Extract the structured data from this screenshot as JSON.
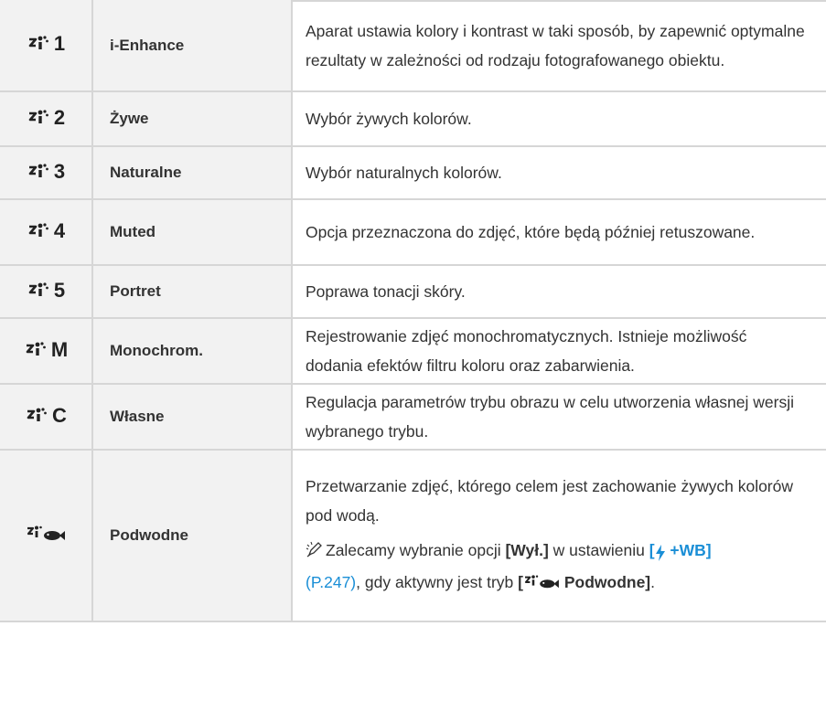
{
  "rows": [
    {
      "icon": "picture-mode-icon",
      "number": "1",
      "name": "i-Enhance",
      "desc": "Aparat ustawia kolory i kontrast w taki sposób, by zapewnić optymalne rezultaty w zależności od rodzaju fotografowanego obiektu."
    },
    {
      "icon": "picture-mode-icon",
      "number": "2",
      "name": "Żywe",
      "desc": "Wybór żywych kolorów."
    },
    {
      "icon": "picture-mode-icon",
      "number": "3",
      "name": "Naturalne",
      "desc": "Wybór naturalnych kolorów."
    },
    {
      "icon": "picture-mode-icon",
      "number": "4",
      "name": "Muted",
      "desc": "Opcja przeznaczona do zdjęć, które będą później retuszowane."
    },
    {
      "icon": "picture-mode-icon",
      "number": "5",
      "name": "Portret",
      "desc": "Poprawa tonacji skóry."
    },
    {
      "icon": "picture-mode-icon",
      "number": "M",
      "name": "Monochrom.",
      "desc": "Rejestrowanie zdjęć monochromatycznych. Istnieje możliwość dodania efektów filtru koloru oraz zabarwienia."
    },
    {
      "icon": "picture-mode-icon",
      "number": "C",
      "name": "Własne",
      "desc": "Regulacja parametrów trybu obrazu w celu utworzenia własnej wersji wybranego trybu."
    },
    {
      "icon": "underwater-mode-icon",
      "number": "",
      "name": "Podwodne",
      "desc": "Przetwarzanie zdjęć, którego celem jest zachowanie żywych kolorów pod wodą."
    }
  ],
  "note": {
    "icon": "hint-pencil-icon",
    "prefix": "Zalecamy wybranie opcji ",
    "option": "[Wył.]",
    "mid": " w ustawieniu ",
    "setting_open": "[",
    "setting_icon": "flash-icon",
    "setting_text": " +WB]",
    "link": "(P.247)",
    "suffix": ", gdy aktywny jest tryb ",
    "mode_open": "[",
    "mode_icon": "underwater-mode-icon",
    "mode_name": " Podwodne]",
    "end": "."
  },
  "colors": {
    "accent": "#1a8ed6",
    "cell_bg": "#f2f2f2",
    "border": "#d6d6d6"
  }
}
